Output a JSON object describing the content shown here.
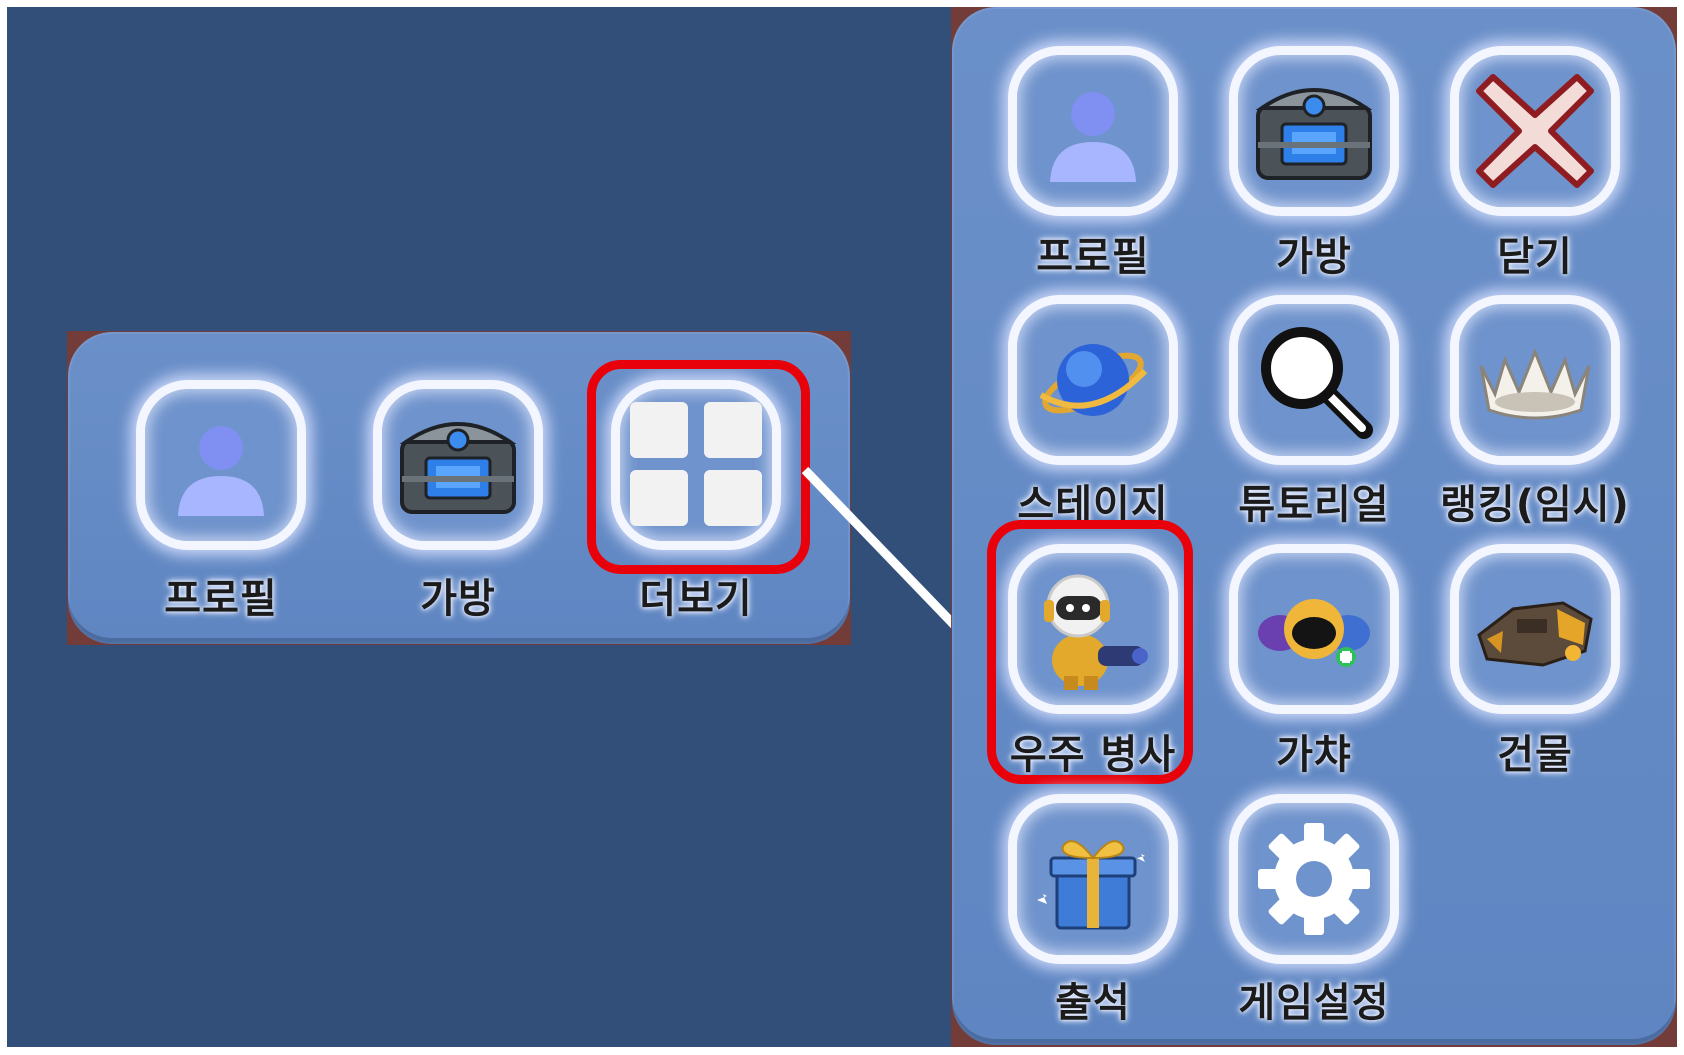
{
  "colors": {
    "background": "#324f79",
    "panel": "#6b90c9",
    "highlight": "#e8000a",
    "label_text": "#1b1b1b"
  },
  "collapsed_menu": {
    "items": [
      {
        "label": "프로필",
        "icon": "profile-icon"
      },
      {
        "label": "가방",
        "icon": "bag-chest-icon"
      },
      {
        "label": "더보기",
        "icon": "grid-more-icon"
      }
    ]
  },
  "expanded_menu": {
    "items": [
      {
        "label": "프로필",
        "icon": "profile-icon"
      },
      {
        "label": "가방",
        "icon": "bag-chest-icon"
      },
      {
        "label": "닫기",
        "icon": "close-icon"
      },
      {
        "label": "스테이지",
        "icon": "planet-icon"
      },
      {
        "label": "튜토리얼",
        "icon": "magnifier-icon"
      },
      {
        "label": "랭킹(임시)",
        "icon": "crown-icon"
      },
      {
        "label": "우주 병사",
        "icon": "space-soldier-icon"
      },
      {
        "label": "가챠",
        "icon": "helmet-gacha-icon"
      },
      {
        "label": "건물",
        "icon": "building-icon"
      },
      {
        "label": "출석",
        "icon": "gift-icon"
      },
      {
        "label": "게임설정",
        "icon": "gear-icon"
      }
    ]
  }
}
